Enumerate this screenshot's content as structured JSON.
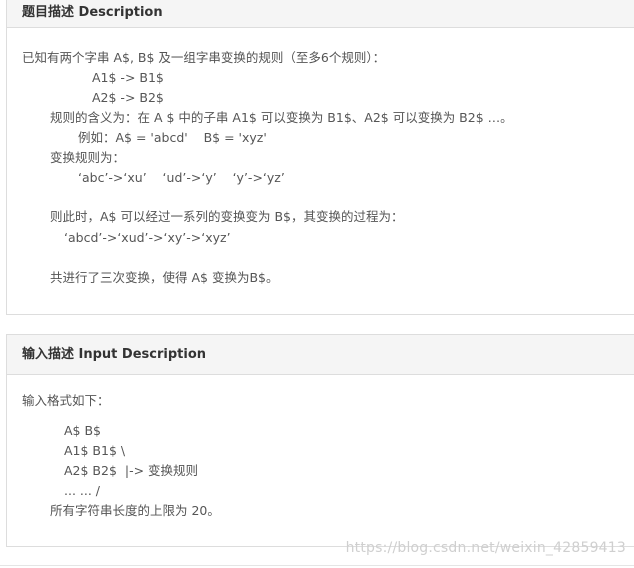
{
  "section1": {
    "title": "题目描述 Description",
    "lines": [
      "已知有两个字串 A$, B$ 及一组字串变换的规则（至多6个规则）：",
      "A1$ -> B1$",
      "A2$ -> B2$",
      "规则的含义为：在 A $ 中的子串 A1$ 可以变换为 B1$、A2$ 可以变换为 B2$ …。",
      "例如：A$ = 'abcd'    B$ = 'xyz'",
      "变换规则为：",
      "‘abc’->‘xu’    ‘ud’->‘y’    ‘y’->‘yz’",
      "则此时，A$ 可以经过一系列的变换变为 B$，其变换的过程为：",
      "‘abcd’->‘xud’->‘xy’->‘xyz’",
      "共进行了三次变换，使得 A$ 变换为B$。"
    ]
  },
  "section2": {
    "title": "输入描述 Input Description",
    "lines": [
      "输入格式如下：",
      "A$ B$",
      "A1$ B1$ \\",
      "A2$ B2$  |-> 变换规则",
      "... ... /",
      "所有字符串长度的上限为 20。"
    ]
  },
  "watermark": "https://blog.csdn.net/weixin_42859413"
}
